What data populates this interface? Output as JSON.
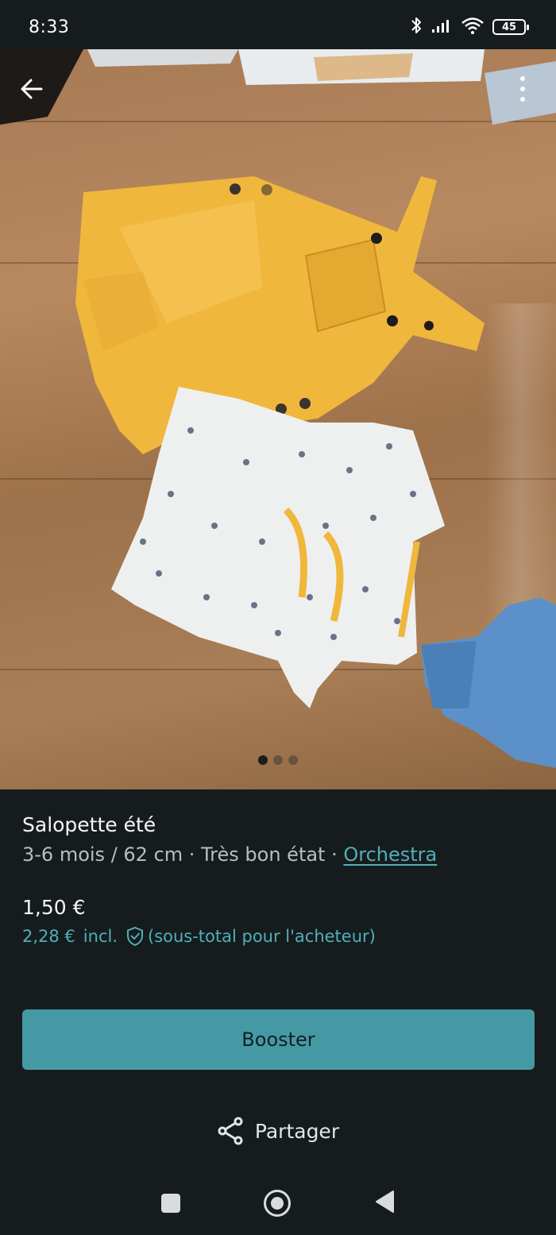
{
  "status_bar": {
    "time": "8:33",
    "battery_level": "45",
    "icons": [
      "bluetooth-icon",
      "signal-icon",
      "wifi-icon",
      "battery-icon"
    ]
  },
  "photo": {
    "image_count": 3,
    "active_index": 0
  },
  "item": {
    "title": "Salopette été",
    "size": "3-6 mois / 62 cm",
    "separator": " · ",
    "condition": "Très bon état",
    "brand": "Orchestra",
    "price": "1,50 €",
    "total_price": "2,28 €",
    "total_incl": "incl.",
    "total_note": "(sous-total pour l'acheteur)"
  },
  "actions": {
    "booster_label": "Booster",
    "share_label": "Partager"
  },
  "colors": {
    "background": "#161c1d",
    "accent": "#4fb0ba",
    "button": "#4599a4"
  }
}
